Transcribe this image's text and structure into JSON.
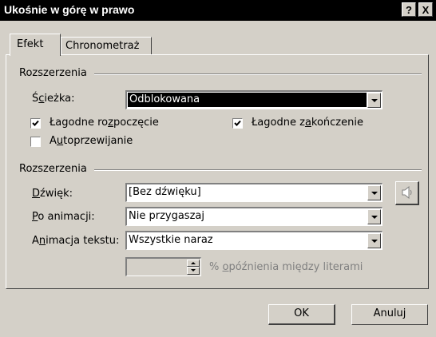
{
  "window": {
    "title": "Ukośnie w górę w prawo",
    "help_label": "?",
    "close_label": "X"
  },
  "tabs": [
    {
      "label": "Efekt",
      "active": true
    },
    {
      "label": "Chronometraż",
      "active": false
    }
  ],
  "group1": {
    "title": "Rozszerzenia",
    "path": {
      "pre": "Ś",
      "ul": "c",
      "post": "ieżka:",
      "value": "Odblokowana"
    },
    "smooth_start": {
      "pre": "Łagodne ro",
      "ul": "z",
      "post": "poczęcie",
      "checked": true
    },
    "smooth_end": {
      "pre": "Łagodne z",
      "ul": "a",
      "post": "kończenie",
      "checked": true
    },
    "auto_reverse": {
      "pre": "A",
      "ul": "u",
      "post": "toprzewijanie",
      "checked": false
    }
  },
  "group2": {
    "title": "Rozszerzenia",
    "sound": {
      "pre": "",
      "ul": "D",
      "post": "źwięk:",
      "value": "[Bez dźwięku]"
    },
    "after_animation": {
      "pre": "",
      "ul": "P",
      "post": "o animacji:",
      "value": "Nie przygaszaj"
    },
    "animate_text": {
      "pre": "A",
      "ul": "n",
      "post": "imacja tekstu:",
      "value": "Wszystkie naraz"
    },
    "delay": {
      "value": "",
      "pre": "% ",
      "ul": "o",
      "post": "późnienia między literami"
    },
    "sound_icon": "speaker-icon"
  },
  "buttons": {
    "ok": "OK",
    "cancel": "Anuluj"
  }
}
